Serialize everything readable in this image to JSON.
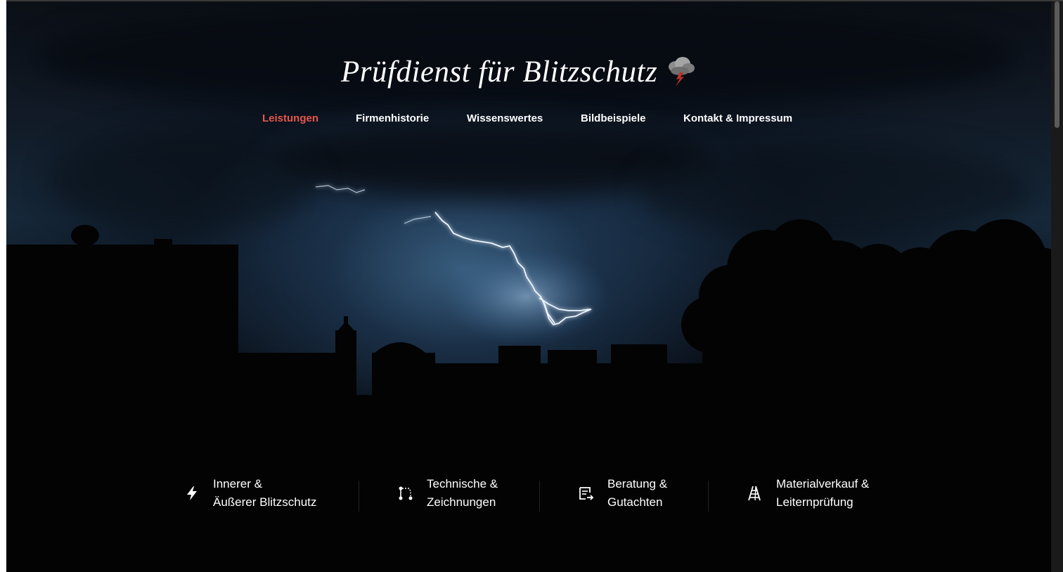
{
  "site": {
    "title": "Prüfdienst für Blitzschutz",
    "logo_icon": "storm-cloud-lightning-icon"
  },
  "nav": {
    "items": [
      {
        "label": "Leistungen",
        "active": true
      },
      {
        "label": "Firmenhistorie",
        "active": false
      },
      {
        "label": "Wissenswertes",
        "active": false
      },
      {
        "label": "Bildbeispiele",
        "active": false
      },
      {
        "label": "Kontakt & Impressum",
        "active": false
      }
    ]
  },
  "services": [
    {
      "line1": "Innerer &",
      "line2": "Äußerer Blitzschutz",
      "icon": "lightning-bolt-icon"
    },
    {
      "line1": "Technische &",
      "line2": "Zeichnungen",
      "icon": "drawing-path-icon"
    },
    {
      "line1": "Beratung &",
      "line2": "Gutachten",
      "icon": "document-arrow-icon"
    },
    {
      "line1": "Materialverkauf &",
      "line2": "Leiternprüfung",
      "icon": "ladder-icon"
    }
  ],
  "colors": {
    "accent": "#e8564b",
    "text": "#ffffff",
    "background": "#050608"
  }
}
